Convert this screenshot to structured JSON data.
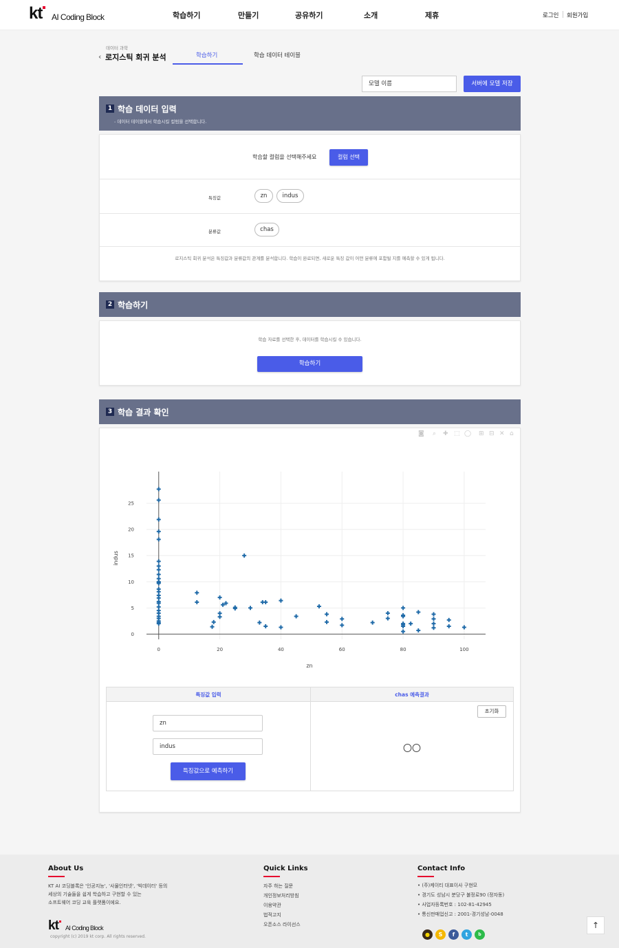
{
  "brand": {
    "logo_mark": "kt",
    "logo_text": "AI Coding Block"
  },
  "nav": {
    "items": [
      "학습하기",
      "만들기",
      "공유하기",
      "소개",
      "제휴"
    ]
  },
  "auth": {
    "login": "로그인",
    "signup": "회원가입"
  },
  "subheader": {
    "category": "데이터 과학",
    "title": "로지스틱 회귀 분석",
    "tabs": [
      "학습하기",
      "학습 데이터 테이블"
    ],
    "active_tab": 0
  },
  "model": {
    "name_value": "모델 이름",
    "save_label": "서버에 모델 저장"
  },
  "section1": {
    "num": "1",
    "title": "학습 데이터 입력",
    "subtitle": "- 데이터 테이블에서 학습시킬 컬럼을 선택합니다.",
    "prompt": "학습할 컬럼을 선택해주세요",
    "select_button": "컬럼 선택",
    "feature_label": "특징값",
    "features": [
      "zn",
      "indus"
    ],
    "class_label": "분류값",
    "classes": [
      "chas"
    ],
    "note": "로지스틱 회귀 분석은 특징값과 분류값의 관계를 분석합니다. 학습이 완료되면, 새로운 특징 값이 어떤 분류에 포함될 지를 예측할 수 있게 됩니다."
  },
  "section2": {
    "num": "2",
    "title": "학습하기",
    "note": "학습 자료를 선택한 후, 데이터를 학습시킬 수 있습니다.",
    "train_button": "학습하기"
  },
  "section3": {
    "num": "3",
    "title": "학습 결과 확인"
  },
  "modebar_icons": [
    "camera-icon",
    "zoom-icon",
    "pan-icon",
    "box-select-icon",
    "lasso-icon",
    "zoom-in-icon",
    "zoom-out-icon",
    "autoscale-icon",
    "reset-axes-icon"
  ],
  "chart_data": {
    "type": "scatter",
    "xlabel": "zn",
    "ylabel": "indus",
    "xlim": [
      -4,
      107
    ],
    "ylim": [
      -1,
      30
    ],
    "xticks": [
      0,
      20,
      40,
      60,
      80,
      100
    ],
    "yticks": [
      0,
      5,
      10,
      15,
      20,
      25
    ],
    "grid": true,
    "marker": "cross",
    "color": "#1f6aa8",
    "points": [
      [
        0,
        27.7
      ],
      [
        0,
        25.6
      ],
      [
        0,
        21.9
      ],
      [
        0,
        19.6
      ],
      [
        0,
        18.1
      ],
      [
        0,
        13.9
      ],
      [
        0,
        13.0
      ],
      [
        0,
        12.3
      ],
      [
        0,
        11.4
      ],
      [
        0,
        10.6
      ],
      [
        0,
        10.0
      ],
      [
        0,
        9.9
      ],
      [
        0,
        9.7
      ],
      [
        0,
        8.6
      ],
      [
        0,
        8.1
      ],
      [
        0,
        7.4
      ],
      [
        0,
        6.9
      ],
      [
        0,
        6.2
      ],
      [
        0,
        5.9
      ],
      [
        0,
        5.2
      ],
      [
        0,
        4.5
      ],
      [
        0,
        4.0
      ],
      [
        0,
        3.4
      ],
      [
        0,
        3.0
      ],
      [
        0,
        2.5
      ],
      [
        0,
        2.2
      ],
      [
        0,
        2.0
      ],
      [
        12.5,
        7.9
      ],
      [
        12.5,
        6.1
      ],
      [
        17.5,
        1.4
      ],
      [
        18,
        2.3
      ],
      [
        20,
        7.0
      ],
      [
        20,
        3.97
      ],
      [
        20,
        3.3
      ],
      [
        21,
        5.6
      ],
      [
        22,
        5.9
      ],
      [
        25,
        5.1
      ],
      [
        25,
        4.9
      ],
      [
        28,
        15.0
      ],
      [
        30,
        5.0
      ],
      [
        33,
        2.2
      ],
      [
        34,
        6.1
      ],
      [
        35,
        6.1
      ],
      [
        35,
        1.5
      ],
      [
        40,
        6.4
      ],
      [
        40,
        1.3
      ],
      [
        45,
        3.4
      ],
      [
        52.5,
        5.3
      ],
      [
        55,
        3.8
      ],
      [
        55,
        2.3
      ],
      [
        60,
        2.9
      ],
      [
        60,
        1.7
      ],
      [
        70,
        2.2
      ],
      [
        75,
        4.0
      ],
      [
        75,
        3.0
      ],
      [
        80,
        5.0
      ],
      [
        80,
        3.6
      ],
      [
        80,
        3.4
      ],
      [
        80,
        2.0
      ],
      [
        80,
        1.8
      ],
      [
        80,
        1.5
      ],
      [
        80,
        0.5
      ],
      [
        82.5,
        2.0
      ],
      [
        85,
        4.2
      ],
      [
        85,
        0.7
      ],
      [
        90,
        3.8
      ],
      [
        90,
        2.9
      ],
      [
        90,
        2.0
      ],
      [
        90,
        1.2
      ],
      [
        95,
        2.7
      ],
      [
        95,
        1.5
      ],
      [
        100,
        1.3
      ]
    ]
  },
  "predict": {
    "input_header": "특징값 입력",
    "result_header": "chas 예측결과",
    "inputs": [
      "zn",
      "indus"
    ],
    "predict_button": "특징값으로 예측하기",
    "reset_button": "초기화",
    "result": "〇〇"
  },
  "footer": {
    "about_title": "About Us",
    "about_text": [
      "KT AI 코딩블록은 '인공지능', '사물인터넷', '빅데이터' 등의",
      "세상의 기술들을 쉽게 학습하고 구현할 수 있는",
      "소프트웨어 코딩 교육 플랫폼이에요."
    ],
    "copyright": "copyright (c) 2019 kt corp. All rights reserved.",
    "links_title": "Quick Links",
    "links": [
      "자주 하는 질문",
      "개인정보처리방침",
      "이용약관",
      "법적고지",
      "오픈소스 라이선스"
    ],
    "contact_title": "Contact Info",
    "contact": [
      "• (주)케이티 대표이사 구현모",
      "• 경기도 성남시 분당구 불정로90 (정자동)",
      "• 사업자등록번호 : 102-81-42945",
      "• 통신판매업신고 : 2001-경기성남-0048"
    ],
    "sns": [
      {
        "name": "kakao-talk-icon",
        "color": "#3a2a1a",
        "glyph": "💬"
      },
      {
        "name": "kakao-story-icon",
        "color": "#f5b800",
        "glyph": "S"
      },
      {
        "name": "facebook-icon",
        "color": "#3b5a9a",
        "glyph": "f"
      },
      {
        "name": "twitter-icon",
        "color": "#2ea4e0",
        "glyph": "t"
      },
      {
        "name": "blog-icon",
        "color": "#2dbb4a",
        "glyph": "b"
      }
    ]
  }
}
